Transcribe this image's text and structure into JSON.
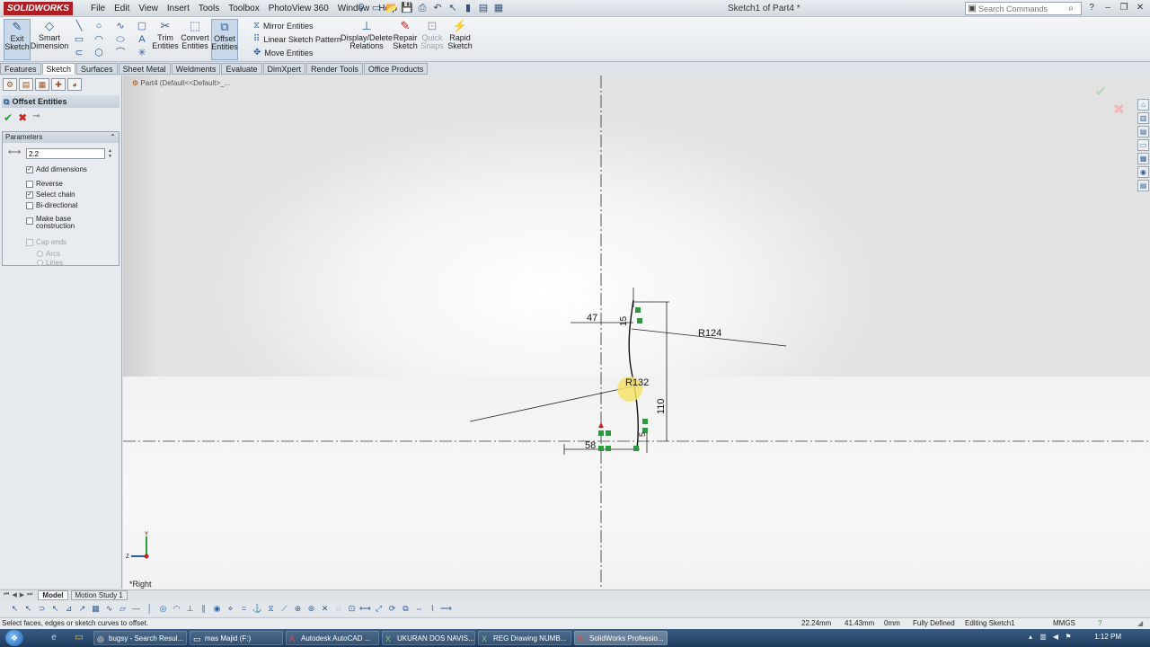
{
  "app": {
    "logo": "SOLIDWORKS",
    "menu": [
      "File",
      "Edit",
      "View",
      "Insert",
      "Tools",
      "Toolbox",
      "PhotoView 360",
      "Window",
      "Help"
    ],
    "document_title": "Sketch1 of Part4 *",
    "search_placeholder": "Search Commands"
  },
  "ribbon": {
    "exit_sketch": "Exit Sketch",
    "smart_dimension": "Smart Dimension",
    "trim_entities": "Trim Entities",
    "convert_entities": "Convert Entities",
    "offset_entities": "Offset Entities",
    "mirror_entities": "Mirror Entities",
    "linear_sketch_pattern": "Linear Sketch Pattern",
    "move_entities": "Move Entities",
    "display_delete_relations": "Display/Delete Relations",
    "repair_sketch": "Repair Sketch",
    "quick_snaps": "Quick Snaps",
    "rapid_sketch": "Rapid Sketch"
  },
  "tabs": [
    {
      "label": "Features",
      "active": false
    },
    {
      "label": "Sketch",
      "active": true
    },
    {
      "label": "Surfaces",
      "active": false
    },
    {
      "label": "Sheet Metal",
      "active": false
    },
    {
      "label": "Weldments",
      "active": false
    },
    {
      "label": "Evaluate",
      "active": false
    },
    {
      "label": "DimXpert",
      "active": false
    },
    {
      "label": "Render Tools",
      "active": false
    },
    {
      "label": "Office Products",
      "active": false
    }
  ],
  "property_manager": {
    "title": "Offset Entities",
    "parameters_label": "Parameters",
    "offset_value": "2.2",
    "options": {
      "add_dimensions": "Add dimensions",
      "reverse": "Reverse",
      "select_chain": "Select chain",
      "bi_directional": "Bi-directional",
      "make_base_construction": "Make base construction",
      "cap_ends": "Cap ends",
      "arcs": "Arcs",
      "lines": "Lines"
    },
    "checked": {
      "add_dimensions": true,
      "reverse": false,
      "select_chain": true,
      "bi_directional": false,
      "make_base_construction": false,
      "cap_ends": false
    }
  },
  "graphics": {
    "breadcrumb": "Part4  (Default<<Default>_...",
    "view_label": "*Right",
    "dimensions": {
      "d47": "47",
      "d15": "15",
      "r124": "R124",
      "r32": "R132",
      "d110": "110",
      "d58": "58",
      "d5": "5"
    }
  },
  "bottom_tabs": [
    {
      "label": "Model",
      "active": true
    },
    {
      "label": "Motion Study 1",
      "active": false
    }
  ],
  "status": {
    "message": "Select faces, edges or sketch curves to offset.",
    "x": "22.24mm",
    "y": "41.43mm",
    "z": "0mm",
    "state": "Fully Defined",
    "editing": "Editing Sketch1",
    "units": "MMGS"
  },
  "taskbar": {
    "tasks": [
      {
        "label": "bugsy - Search Resul...",
        "active": false
      },
      {
        "label": "mas Majid (F:)",
        "active": false
      },
      {
        "label": "Autodesk AutoCAD ...",
        "active": false
      },
      {
        "label": "UKURAN DOS NAVIS...",
        "active": false
      },
      {
        "label": "REG Drawing NUMB...",
        "active": false
      },
      {
        "label": "SolidWorks Professio...",
        "active": true
      }
    ],
    "clock": "1:12 PM"
  }
}
